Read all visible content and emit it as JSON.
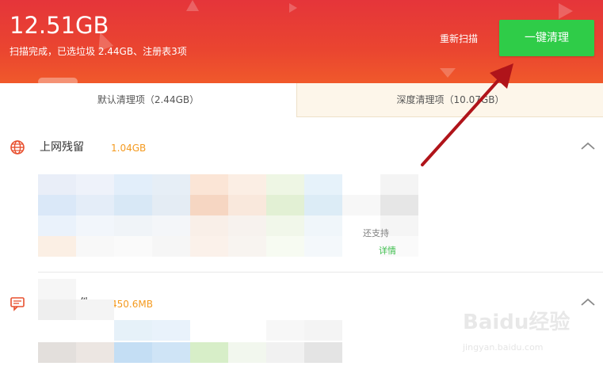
{
  "summary": {
    "total_size": "12.51GB",
    "scan_status": "扫描完成，已选垃圾 2.44GB、注册表3项"
  },
  "actions": {
    "rescan_label": "重新扫描",
    "one_click_label": "一键清理"
  },
  "tabs": [
    {
      "label": "默认清理项（2.44GB）",
      "active": true
    },
    {
      "label": "深度清理项（10.07GB）",
      "active": false
    }
  ],
  "sections": [
    {
      "title": "上网残留",
      "size": "1.04GB",
      "icon": "globe-icon",
      "card_text": "还支持",
      "detail_label": "详情"
    },
    {
      "title": "件",
      "size": "450.6MB",
      "icon": "chat-icon"
    }
  ],
  "watermark": {
    "brand": "Baidu经验",
    "url": "jingyan.baidu.com"
  },
  "colors": {
    "header_top": "#e5353a",
    "header_bottom": "#f0592b",
    "primary_button": "#2fcc48",
    "size_text": "#f49a1f",
    "deep_tab_bg": "#fdf6ea",
    "arrow": "#b0141a"
  }
}
